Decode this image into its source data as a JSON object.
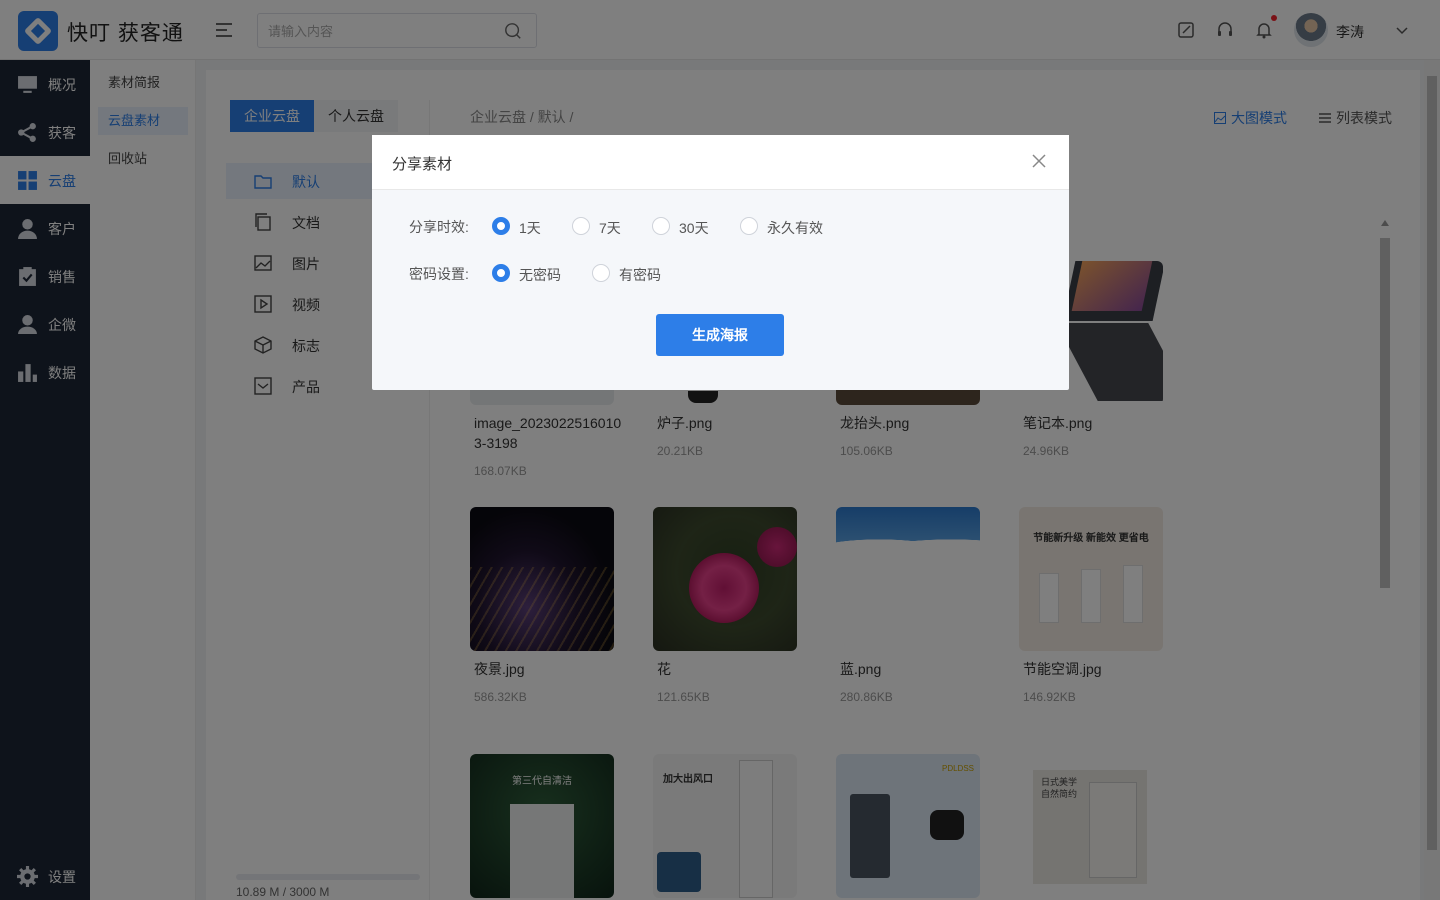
{
  "app": {
    "title": "快叮 获客通"
  },
  "header": {
    "search_placeholder": "请输入内容",
    "user_name": "李涛",
    "icons": [
      "menu-fold-icon",
      "search-icon",
      "edit-icon",
      "headset-icon",
      "bell-icon",
      "chevron-down-icon"
    ]
  },
  "sidebar": {
    "items": [
      {
        "label": "概况",
        "icon": "monitor-icon"
      },
      {
        "label": "获客",
        "icon": "share-icon"
      },
      {
        "label": "云盘",
        "icon": "grid-icon",
        "active": true
      },
      {
        "label": "客户",
        "icon": "user-icon"
      },
      {
        "label": "销售",
        "icon": "checklist-icon"
      },
      {
        "label": "企微",
        "icon": "wecom-icon"
      },
      {
        "label": "数据",
        "icon": "bar-chart-icon"
      }
    ],
    "settings_label": "设置"
  },
  "subnav": {
    "items": [
      {
        "label": "素材简报"
      },
      {
        "label": "云盘素材",
        "active": true
      },
      {
        "label": "回收站"
      }
    ]
  },
  "cloud": {
    "tabs": [
      "企业云盘",
      "个人云盘"
    ],
    "folders": [
      {
        "label": "默认",
        "icon": "folder-icon"
      },
      {
        "label": "文档",
        "icon": "copy-icon"
      },
      {
        "label": "图片",
        "icon": "image-icon"
      },
      {
        "label": "视频",
        "icon": "video-icon"
      },
      {
        "label": "标志",
        "icon": "cube-icon"
      },
      {
        "label": "产品",
        "icon": "inbox-icon"
      }
    ],
    "storage": "10.89 M / 3000 M",
    "breadcrumb": "企业云盘 / 默认 /",
    "view_large": "大图模式",
    "view_list": "列表模式"
  },
  "files": [
    {
      "name": "image_20230225160103-3198",
      "size": "168.07KB"
    },
    {
      "name": "炉子.png",
      "size": "20.21KB"
    },
    {
      "name": "龙抬头.png",
      "size": "105.06KB"
    },
    {
      "name": "笔记本.png",
      "size": "24.96KB"
    },
    {
      "name": "夜景.jpg",
      "size": "586.32KB"
    },
    {
      "name": "花",
      "size": "121.65KB"
    },
    {
      "name": "蓝.png",
      "size": "280.86KB"
    },
    {
      "name": "节能空调.jpg",
      "size": "146.92KB"
    }
  ],
  "thumb_texts": {
    "aircon_title": "节能新升级 新能效 更省电",
    "clean_title": "第三代自清洁",
    "outlet_title": "加大出风口",
    "panel_title": "PDLDSS",
    "fridge_text": "日式美学 自然简约"
  },
  "modal": {
    "title": "分享素材",
    "validity_label": "分享时效:",
    "validity_options": [
      "1天",
      "7天",
      "30天",
      "永久有效"
    ],
    "validity_selected": "1天",
    "password_label": "密码设置:",
    "password_options": [
      "无密码",
      "有密码"
    ],
    "password_selected": "无密码",
    "generate_button": "生成海报"
  },
  "colors": {
    "primary": "#2d7ee8",
    "sidebar_bg": "#1d2736",
    "notification": "#f5222d"
  }
}
